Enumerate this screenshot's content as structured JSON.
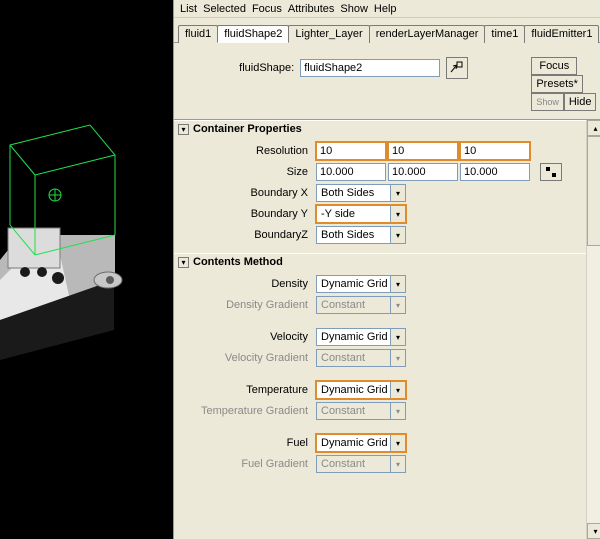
{
  "menu": {
    "items": [
      "List",
      "Selected",
      "Focus",
      "Attributes",
      "Show",
      "Help"
    ]
  },
  "tabs": [
    {
      "label": "fluid1"
    },
    {
      "label": "fluidShape2",
      "active": true
    },
    {
      "label": "Lighter_Layer"
    },
    {
      "label": "renderLayerManager"
    },
    {
      "label": "time1"
    },
    {
      "label": "fluidEmitter1"
    }
  ],
  "header": {
    "label": "fluidShape:",
    "value": "fluidShape2",
    "buttons": {
      "focus": "Focus",
      "presets": "Presets*",
      "show": "Show",
      "hide": "Hide"
    }
  },
  "sections": {
    "container": {
      "title": "Container Properties",
      "rows": {
        "resolution": {
          "label": "Resolution",
          "v": [
            "10",
            "10",
            "10"
          ]
        },
        "size": {
          "label": "Size",
          "v": [
            "10.000",
            "10.000",
            "10.000"
          ]
        },
        "boundaryX": {
          "label": "Boundary X",
          "value": "Both Sides"
        },
        "boundaryY": {
          "label": "Boundary Y",
          "value": "-Y side"
        },
        "boundaryZ": {
          "label": "BoundaryZ",
          "value": "Both Sides"
        }
      }
    },
    "contents": {
      "title": "Contents Method",
      "rows": {
        "density": {
          "label": "Density",
          "value": "Dynamic Grid"
        },
        "densityGrad": {
          "label": "Density Gradient",
          "value": "Constant"
        },
        "velocity": {
          "label": "Velocity",
          "value": "Dynamic Grid"
        },
        "velocityGrad": {
          "label": "Velocity Gradient",
          "value": "Constant"
        },
        "temperature": {
          "label": "Temperature",
          "value": "Dynamic Grid"
        },
        "temperatureGrad": {
          "label": "Temperature Gradient",
          "value": "Constant"
        },
        "fuel": {
          "label": "Fuel",
          "value": "Dynamic Grid"
        },
        "fuelGrad": {
          "label": "Fuel Gradient",
          "value": "Constant"
        }
      }
    }
  }
}
